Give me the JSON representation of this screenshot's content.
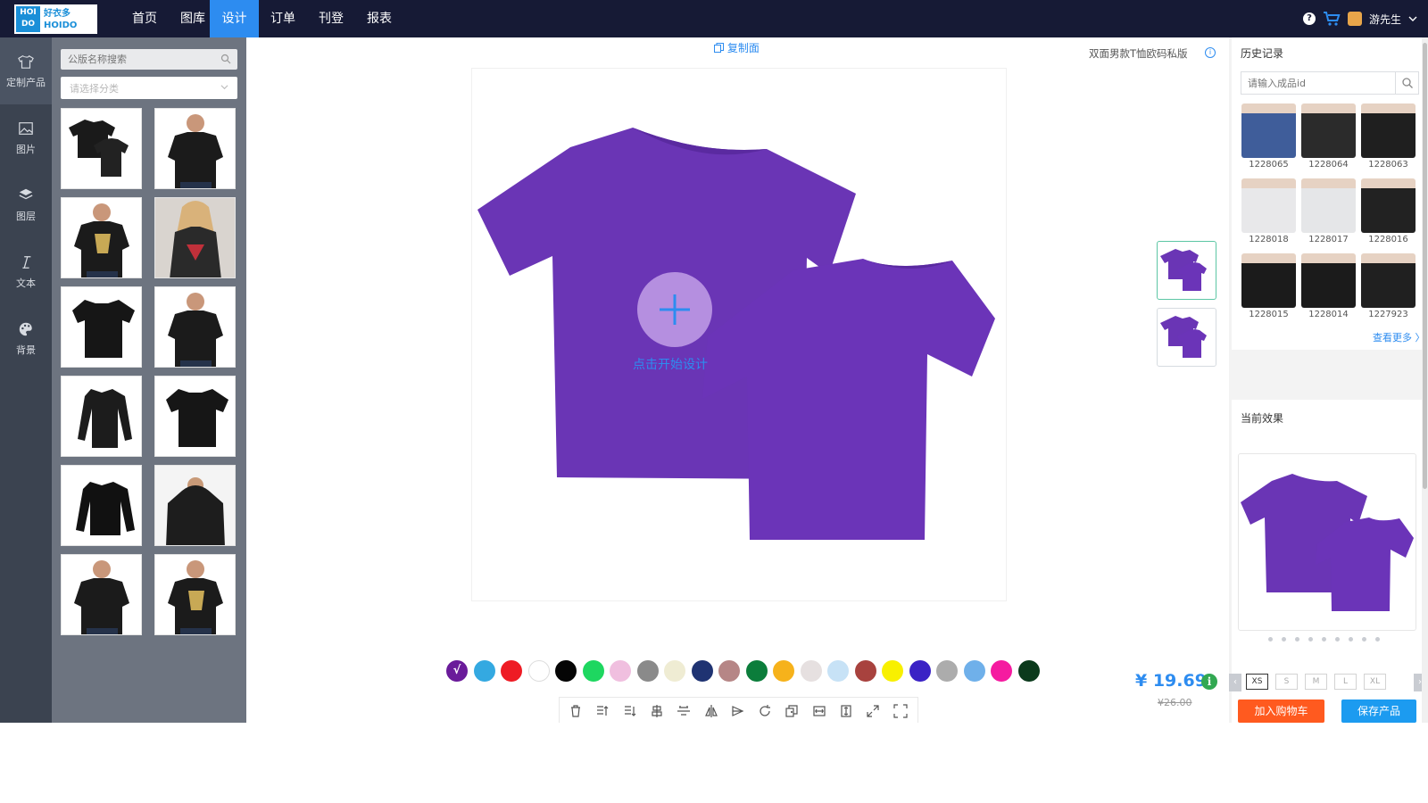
{
  "nav": {
    "logo": {
      "block_text": "HOI DO",
      "brand_cn": "好衣多",
      "brand_en": "HOIDO"
    },
    "items": [
      {
        "label": "首页",
        "active": false
      },
      {
        "label": "图库",
        "active": false
      },
      {
        "label": "设计",
        "active": true
      },
      {
        "label": "订单",
        "active": false
      },
      {
        "label": "刊登",
        "active": false
      },
      {
        "label": "报表",
        "active": false
      }
    ],
    "help_icon": "?",
    "user_name": "游先生"
  },
  "rail": [
    {
      "label": "定制产品",
      "icon": "tshirt-icon",
      "active": true
    },
    {
      "label": "图片",
      "icon": "image-icon",
      "active": false
    },
    {
      "label": "图层",
      "icon": "layers-icon",
      "active": false
    },
    {
      "label": "文本",
      "icon": "text-icon",
      "active": false
    },
    {
      "label": "背景",
      "icon": "palette-icon",
      "active": false
    }
  ],
  "product_panel": {
    "search_placeholder": "公版名称搜索",
    "category_placeholder": "请选择分类",
    "thumbnails": [
      {
        "name": "black-tee-double",
        "style": "double"
      },
      {
        "name": "black-tee-model",
        "style": "model"
      },
      {
        "name": "black-tee-print-model",
        "style": "model-print"
      },
      {
        "name": "graphic-tee-woman",
        "style": "woman"
      },
      {
        "name": "black-tee-flat",
        "style": "flat"
      },
      {
        "name": "black-tee-model-2",
        "style": "model"
      },
      {
        "name": "black-longsleeve",
        "style": "longsleeve"
      },
      {
        "name": "black-vneck",
        "style": "flat"
      },
      {
        "name": "black-sweatshirt",
        "style": "sweatshirt"
      },
      {
        "name": "black-hoodie-model",
        "style": "hoodie"
      },
      {
        "name": "black-tee-model-3",
        "style": "model"
      },
      {
        "name": "you-sus-tee-model",
        "style": "model-print"
      }
    ]
  },
  "canvas": {
    "copy_face_label": "复制面",
    "product_title": "双面男款T恤欧码私版",
    "start_label": "点击开始设计",
    "shirt_color": "#6a35b5"
  },
  "swatches": [
    {
      "color": "#6a1b9a",
      "selected": true,
      "check": "√"
    },
    {
      "color": "#34a9e1"
    },
    {
      "color": "#ee1b24"
    },
    {
      "color": "#ffffff"
    },
    {
      "color": "#050505"
    },
    {
      "color": "#1ed760"
    },
    {
      "color": "#f0bfdf"
    },
    {
      "color": "#8a8a8a"
    },
    {
      "color": "#efecd3"
    },
    {
      "color": "#1f3372"
    },
    {
      "color": "#b68686"
    },
    {
      "color": "#0b7d3b"
    },
    {
      "color": "#f6b21b"
    },
    {
      "color": "#e6e0e0"
    },
    {
      "color": "#c7e2f6"
    },
    {
      "color": "#a8423e"
    },
    {
      "color": "#f8f000"
    },
    {
      "color": "#3a22c5"
    },
    {
      "color": "#acacac"
    },
    {
      "color": "#6fb0ea"
    },
    {
      "color": "#f51ba0"
    },
    {
      "color": "#0b3a1c"
    }
  ],
  "toolbar": [
    "trash-icon",
    "bring-forward-icon",
    "send-backward-icon",
    "align-center-icon",
    "align-middle-icon",
    "flip-horizontal-icon",
    "flip-vertical-icon",
    "rotate-icon",
    "duplicate-icon",
    "fit-width-icon",
    "fit-height-icon",
    "expand-icon",
    "fullscreen-icon"
  ],
  "price": {
    "current": "¥ 19.69",
    "original": "¥26.00",
    "info_icon": "i"
  },
  "history": {
    "title": "历史记录",
    "search_placeholder": "请输入成品id",
    "items": [
      {
        "id": "1228065",
        "color": "#3f5d9a"
      },
      {
        "id": "1228064",
        "color": "#2b2b2b"
      },
      {
        "id": "1228063",
        "color": "#1f1f1f"
      },
      {
        "id": "1228018",
        "color": "#e8e8ea"
      },
      {
        "id": "1228017",
        "color": "#e5e6e8"
      },
      {
        "id": "1228016",
        "color": "#222222"
      },
      {
        "id": "1228015",
        "color": "#1b1b1b"
      },
      {
        "id": "1228014",
        "color": "#1b1b1b"
      },
      {
        "id": "1227923",
        "color": "#202020"
      }
    ],
    "more_label": "查看更多 〉"
  },
  "effect": {
    "title": "当前效果",
    "page_dots": 9,
    "size_prev": "‹",
    "size_next": "›",
    "sizes": [
      {
        "label": "XS",
        "active": true
      },
      {
        "label": "S",
        "active": false
      },
      {
        "label": "M",
        "active": false
      },
      {
        "label": "L",
        "active": false
      },
      {
        "label": "XL",
        "active": false
      }
    ],
    "add_to_cart": "加入购物车",
    "save_product": "保存产品"
  }
}
